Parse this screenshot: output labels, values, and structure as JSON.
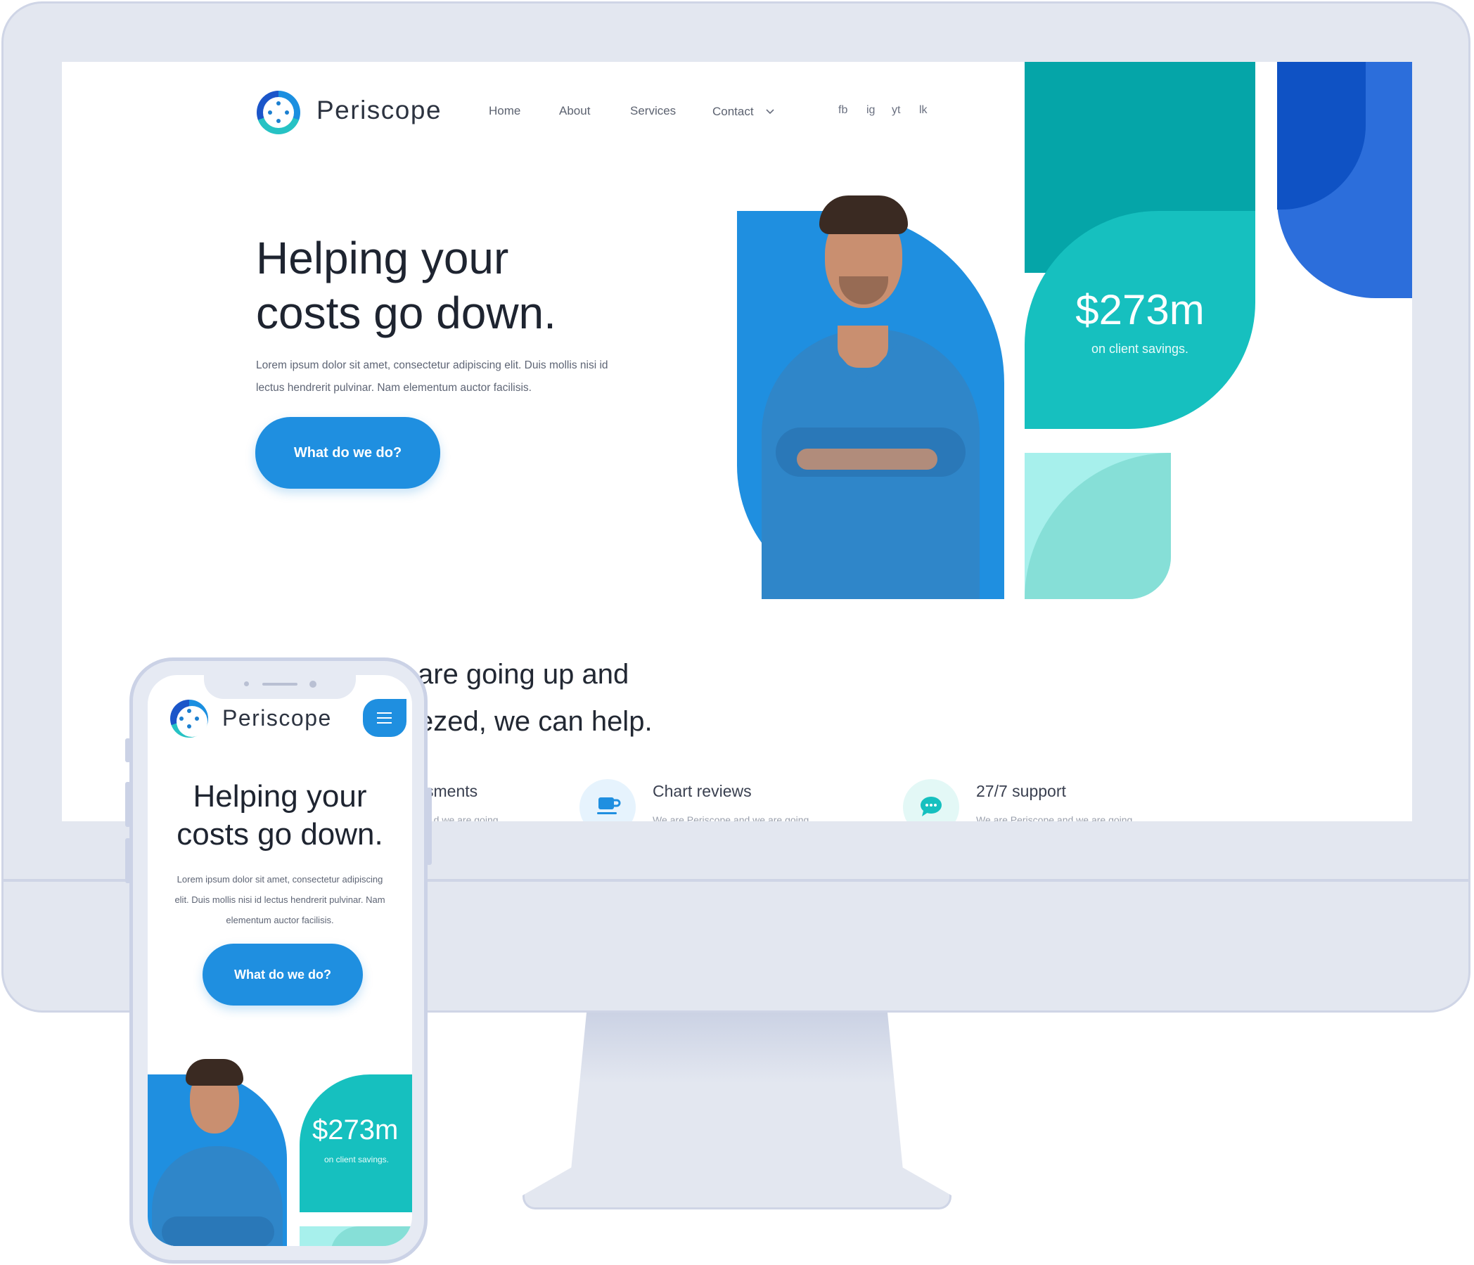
{
  "brand": {
    "name": "Periscope"
  },
  "nav": {
    "links": [
      "Home",
      "About",
      "Services",
      "Contact"
    ],
    "social": [
      "fb",
      "ig",
      "yt",
      "lk"
    ]
  },
  "hero": {
    "headline_line1": "Helping your",
    "headline_line2": "costs go down.",
    "lead_line1": "Lorem ipsum dolor sit amet, consectetur adipiscing elit. Duis mollis nisi id",
    "lead_line2": "lectus hendrerit pulvinar. Nam elementum auctor facilisis.",
    "cta_label": "What do we do?"
  },
  "stat": {
    "value": "$273m",
    "label": "on client savings."
  },
  "section": {
    "title_line1": "are going up and",
    "title_line2": "ezed, we can help."
  },
  "features": [
    {
      "title": "sments",
      "sub": "...d we are going"
    },
    {
      "title": "Chart reviews",
      "sub": "We are Periscope and we are going",
      "icon": "coffee-cup-icon"
    },
    {
      "title": "27/7 support",
      "sub": "We are Periscope and we are going",
      "icon": "chat-bubble-icon"
    }
  ],
  "mobile": {
    "brand": "Periscope",
    "headline_line1": "Helping your",
    "headline_line2": "costs go down.",
    "lead_line1": "Lorem ipsum dolor sit amet, consectetur adipiscing",
    "lead_line2": "elit. Duis mollis nisi id lectus hendrerit pulvinar. Nam",
    "lead_line3": "elementum auctor facilisis.",
    "cta_label": "What do we do?",
    "stat_value": "$273m",
    "stat_label": "on client savings."
  },
  "colors": {
    "primary": "#1f8fe0",
    "teal": "#16c0bf",
    "teal_dark": "#05a5a8",
    "mint": "#a7f0ec",
    "navy": "#0f52c4"
  }
}
